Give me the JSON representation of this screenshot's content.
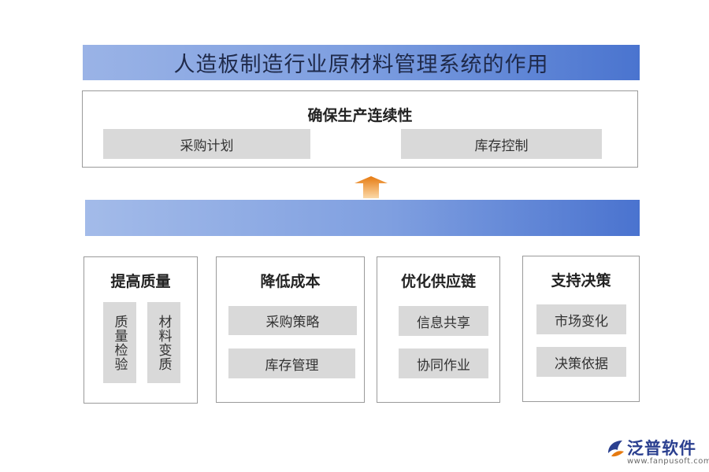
{
  "header": {
    "title": "人造板制造行业原材料管理系统的作用"
  },
  "top": {
    "title": "确保生产连续性",
    "items": [
      "采购计划",
      "库存控制"
    ]
  },
  "cards": [
    {
      "title": "提高质量",
      "items": [
        "质量检验",
        "材料变质"
      ]
    },
    {
      "title": "降低成本",
      "items": [
        "采购策略",
        "库存管理"
      ]
    },
    {
      "title": "优化供应链",
      "items": [
        "信息共享",
        "协同作业"
      ]
    },
    {
      "title": "支持决策",
      "items": [
        "市场变化",
        "决策依据"
      ]
    }
  ],
  "logo": {
    "name": "泛普软件",
    "url": "www.fanpusoft.com"
  },
  "colors": {
    "banner_end": "#4a74cf",
    "pill": "#d9d9d9",
    "arrow": "#f0901c"
  }
}
